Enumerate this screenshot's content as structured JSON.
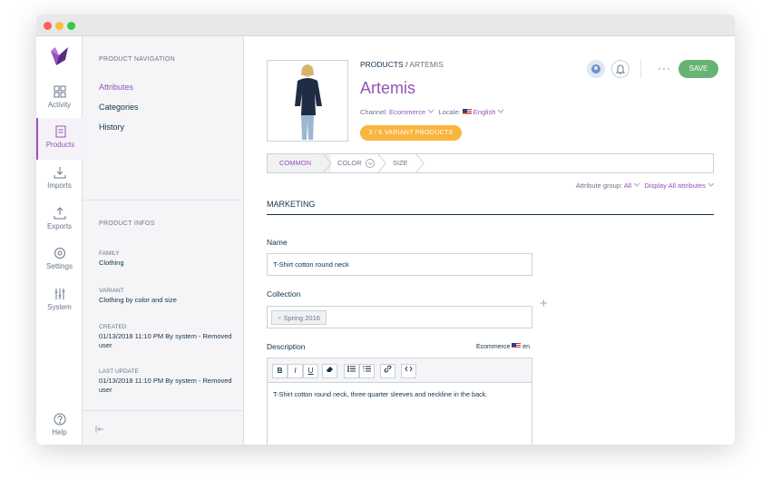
{
  "menu": {
    "items": [
      {
        "label": "Activity",
        "icon": "activity-icon"
      },
      {
        "label": "Products",
        "icon": "products-icon"
      },
      {
        "label": "Imports",
        "icon": "imports-icon"
      },
      {
        "label": "Exports",
        "icon": "exports-icon"
      },
      {
        "label": "Settings",
        "icon": "settings-icon"
      },
      {
        "label": "System",
        "icon": "system-icon"
      },
      {
        "label": "Help",
        "icon": "help-icon"
      }
    ],
    "active": "Products"
  },
  "column": {
    "nav_title": "PRODUCT NAVIGATION",
    "nav_items": [
      "Attributes",
      "Categories",
      "History"
    ],
    "infos_title": "PRODUCT INFOS",
    "infos": [
      {
        "label": "FAMILY",
        "value": "Clothing"
      },
      {
        "label": "VARIANT",
        "value": "Clothing by color and size"
      },
      {
        "label": "CREATED",
        "value": "01/13/2018 11:10 PM By system - Removed user"
      },
      {
        "label": "LAST UPDATE",
        "value": "01/13/2018 11:10 PM By system - Removed user"
      }
    ]
  },
  "header": {
    "breadcrumb_root": "PRODUCTS",
    "breadcrumb_sep": " / ",
    "breadcrumb_current": "ARTEMIS",
    "title": "Artemis",
    "channel_label": "Channel:",
    "channel_value": "Ecommerce",
    "locale_label": "Locale:",
    "locale_value": "English",
    "variant_pill": "3 / 6 VARIANT PRODUCTS",
    "save_label": "SAVE",
    "more_label": "···"
  },
  "tabs": [
    "COMMON",
    "COLOR",
    "SIZE"
  ],
  "attribute_group": {
    "label": "Attribute group:",
    "value": "All",
    "display_all": "Display All attributes"
  },
  "form": {
    "section": "MARKETING",
    "name_label": "Name",
    "name_value": "T-Shirt cotton round neck",
    "collection_label": "Collection",
    "collection_tag": "Spring 2016",
    "description_label": "Description",
    "description_scope_channel": "Ecommerce",
    "description_scope_locale": "en",
    "description_value": "T-Shirt cotton round neck, three quarter sleeves and neckline in the back.",
    "toolbar": [
      "B",
      "I",
      "U"
    ]
  },
  "colors": {
    "accent": "#9452ba",
    "save": "#67b373",
    "pill": "#f9b53f"
  }
}
